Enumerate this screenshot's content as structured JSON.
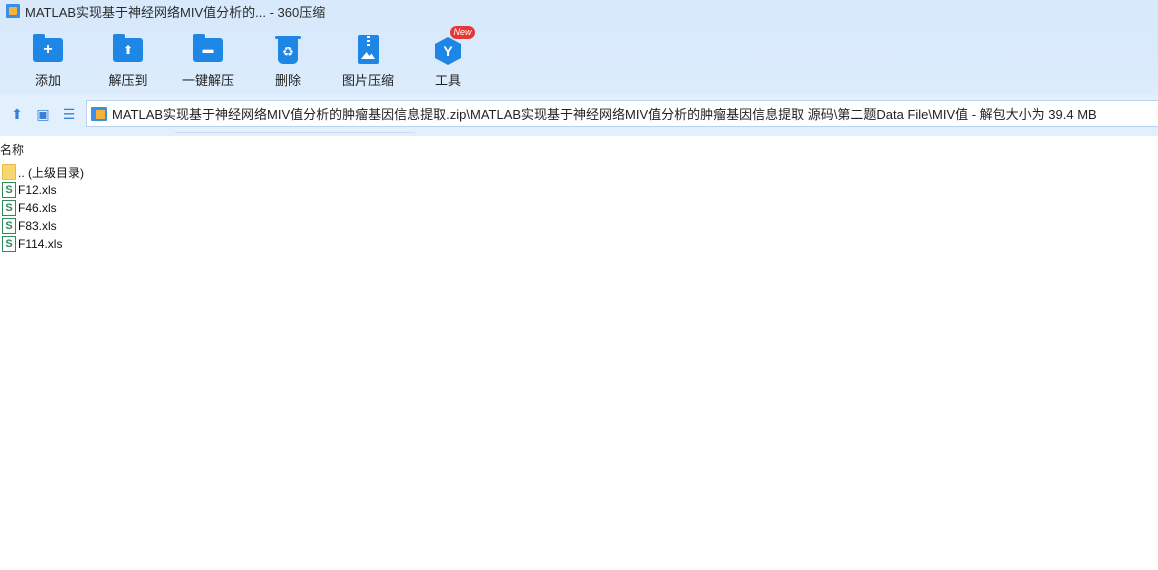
{
  "window": {
    "title": "MATLAB实现基于神经网络MIV值分析的... - 360压缩"
  },
  "toolbar": {
    "items": [
      {
        "label": "添加",
        "icon": "add-folder-icon",
        "glyph": "+"
      },
      {
        "label": "解压到",
        "icon": "extract-folder-icon",
        "glyph": "⬆"
      },
      {
        "label": "一键解压",
        "icon": "oneclick-extract-icon",
        "glyph": "▬"
      },
      {
        "label": "删除",
        "icon": "recycle-bin-icon",
        "glyph": "♻"
      },
      {
        "label": "图片压缩",
        "icon": "image-compress-icon",
        "glyph": ""
      },
      {
        "label": "工具",
        "icon": "tools-cube-icon",
        "glyph": "Y",
        "badge": "New"
      }
    ]
  },
  "navbar": {
    "address": "MATLAB实现基于神经网络MIV值分析的肿瘤基因信息提取.zip\\MATLAB实现基于神经网络MIV值分析的肿瘤基因信息提取 源码\\第二题Data File\\MIV值 - 解包大小为 39.4 MB",
    "up_glyph": "⬆",
    "view_glyph": "▣",
    "list_glyph": "☰"
  },
  "list": {
    "column_name": "名称",
    "rows": [
      {
        "name": ".. (上级目录)",
        "type": "folder"
      },
      {
        "name": "F12.xls",
        "type": "xls",
        "glyph": "S"
      },
      {
        "name": "F46.xls",
        "type": "xls",
        "glyph": "S"
      },
      {
        "name": "F83.xls",
        "type": "xls",
        "glyph": "S"
      },
      {
        "name": "F114.xls",
        "type": "xls",
        "glyph": "S"
      }
    ]
  },
  "colors": {
    "accent": "#1e86e5",
    "toolbar_bg": "#d7e9fb",
    "badge": "#e53935",
    "xls": "#2e8b57"
  }
}
